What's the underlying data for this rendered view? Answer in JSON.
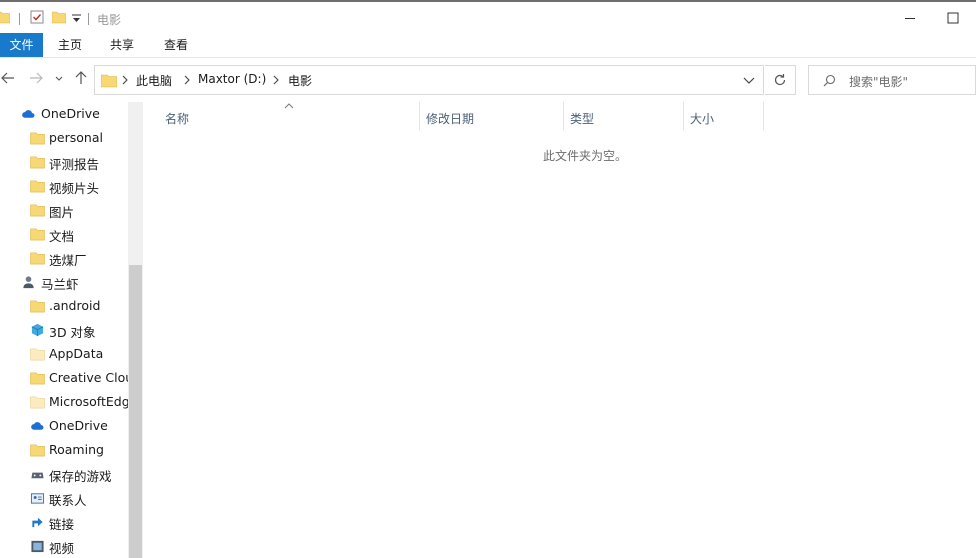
{
  "window": {
    "title": "电影"
  },
  "ribbon": {
    "tabs": [
      "文件",
      "主页",
      "共享",
      "查看"
    ]
  },
  "address": {
    "crumbs": [
      "此电脑",
      "Maxtor (D:)",
      "电影"
    ]
  },
  "search": {
    "placeholder": "搜索\"电影\""
  },
  "sidebar": {
    "items": [
      {
        "label": "OneDrive",
        "icon": "cloud-icon"
      },
      {
        "label": "personal",
        "icon": "folder-icon"
      },
      {
        "label": "评测报告",
        "icon": "folder-icon"
      },
      {
        "label": "视频片头",
        "icon": "folder-icon"
      },
      {
        "label": "图片",
        "icon": "folder-icon"
      },
      {
        "label": "文档",
        "icon": "folder-icon"
      },
      {
        "label": "选煤厂",
        "icon": "folder-icon"
      },
      {
        "label": "马兰虾",
        "icon": "user-icon"
      },
      {
        "label": ".android",
        "icon": "folder-icon"
      },
      {
        "label": "3D 对象",
        "icon": "cube-icon"
      },
      {
        "label": "AppData",
        "icon": "folder-light-icon"
      },
      {
        "label": "Creative Cloud Files",
        "icon": "folder-icon"
      },
      {
        "label": "MicrosoftEdgeBackups",
        "icon": "folder-light-icon"
      },
      {
        "label": "OneDrive",
        "icon": "cloud-icon"
      },
      {
        "label": "Roaming",
        "icon": "folder-icon"
      },
      {
        "label": "保存的游戏",
        "icon": "games-icon"
      },
      {
        "label": "联系人",
        "icon": "contacts-icon"
      },
      {
        "label": "链接",
        "icon": "link-icon"
      },
      {
        "label": "视频",
        "icon": "video-icon"
      }
    ]
  },
  "content": {
    "columns": [
      "名称",
      "修改日期",
      "类型",
      "大小"
    ],
    "empty_message": "此文件夹为空。"
  },
  "colors": {
    "accent": "#1979ca",
    "folder": "#f8d775",
    "folder_light": "#fcebc0"
  }
}
